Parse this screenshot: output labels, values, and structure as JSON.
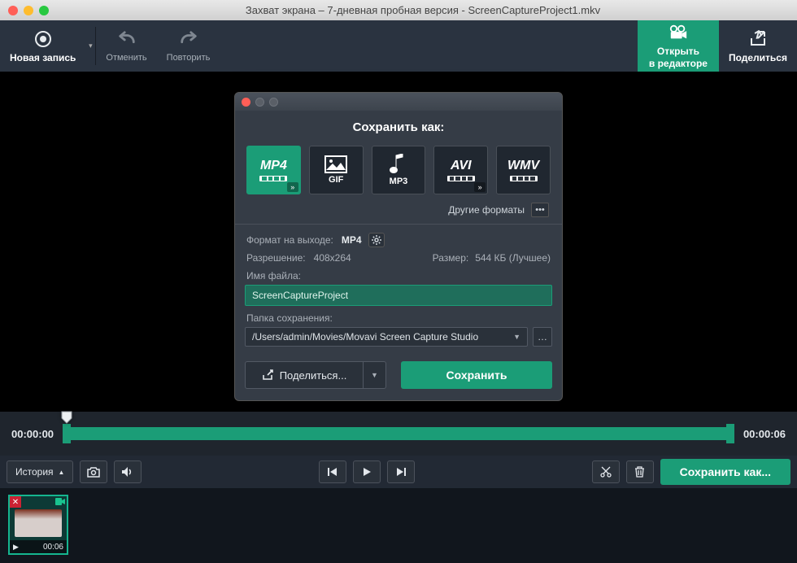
{
  "window": {
    "title": "Захват экрана – 7-дневная пробная версия - ScreenCaptureProject1.mkv"
  },
  "toolbar": {
    "newrec": "Новая запись",
    "undo": "Отменить",
    "redo": "Повторить",
    "open_editor_l1": "Открыть",
    "open_editor_l2": "в редакторе",
    "share": "Поделиться"
  },
  "dialog": {
    "title": "Сохранить как:",
    "formats": {
      "mp4": "MP4",
      "gif": "GIF",
      "mp3": "MP3",
      "avi": "AVI",
      "wmv": "WMV"
    },
    "other_formats": "Другие форматы",
    "out_format_label": "Формат на выходе:",
    "out_format_value": "MP4",
    "resolution_label": "Разрешение:",
    "resolution_value": "408x264",
    "size_label": "Размер:",
    "size_value": "544 КБ (Лучшее)",
    "filename_label": "Имя файла:",
    "filename_value": "ScreenCaptureProject",
    "folder_label": "Папка сохранения:",
    "folder_value": "/Users/admin/Movies/Movavi Screen Capture Studio",
    "share_btn": "Поделиться...",
    "save_btn": "Сохранить"
  },
  "timeline": {
    "start": "00:00:00",
    "end": "00:00:06"
  },
  "controls": {
    "history": "История",
    "save_as": "Сохранить как..."
  },
  "thumb": {
    "duration": "00:06"
  }
}
